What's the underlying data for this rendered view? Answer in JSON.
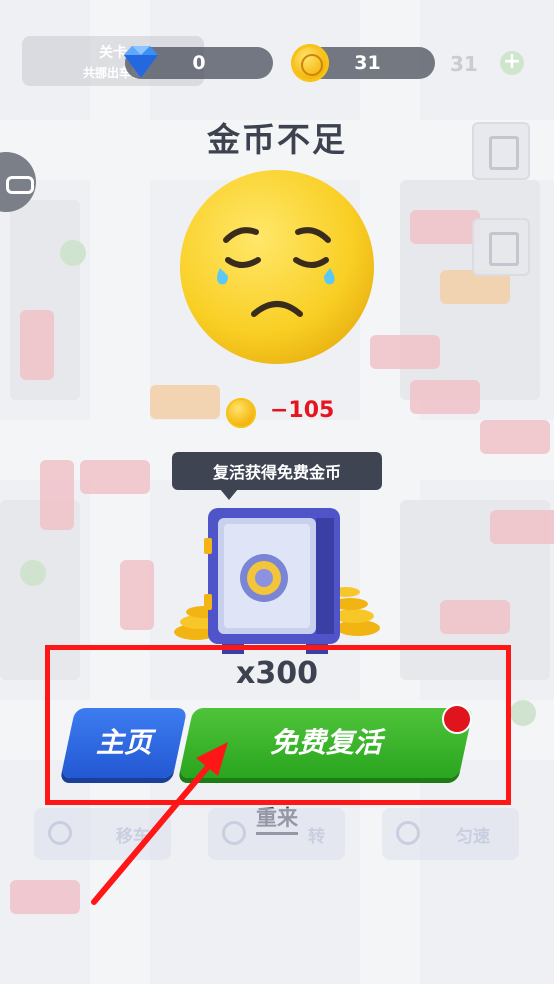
{
  "hud": {
    "level_line1": "关卡",
    "level_line2": "共挪出车辆",
    "gems": "0",
    "coins": "31",
    "coins_ghost": "31",
    "plus": "+"
  },
  "dialog": {
    "title": "金币不足",
    "cost": "−105",
    "tooltip": "复活获得免费金币",
    "multiplier": "x300",
    "home_label": "主页",
    "revive_label": "免费复活",
    "retry_label": "重来"
  },
  "toolbar_ghost": {
    "move_label": "移车",
    "rotate_label": "转",
    "speed_label": "匀速"
  },
  "colors": {
    "home_button": "#2f6ae6",
    "revive_button": "#3cb52c",
    "cost_text": "#e5141e",
    "highlight": "#ff1616"
  },
  "icons": {
    "gem": "gem-icon",
    "coin": "coin-icon",
    "emoji": "crying-face-icon",
    "safe": "safe-icon"
  }
}
